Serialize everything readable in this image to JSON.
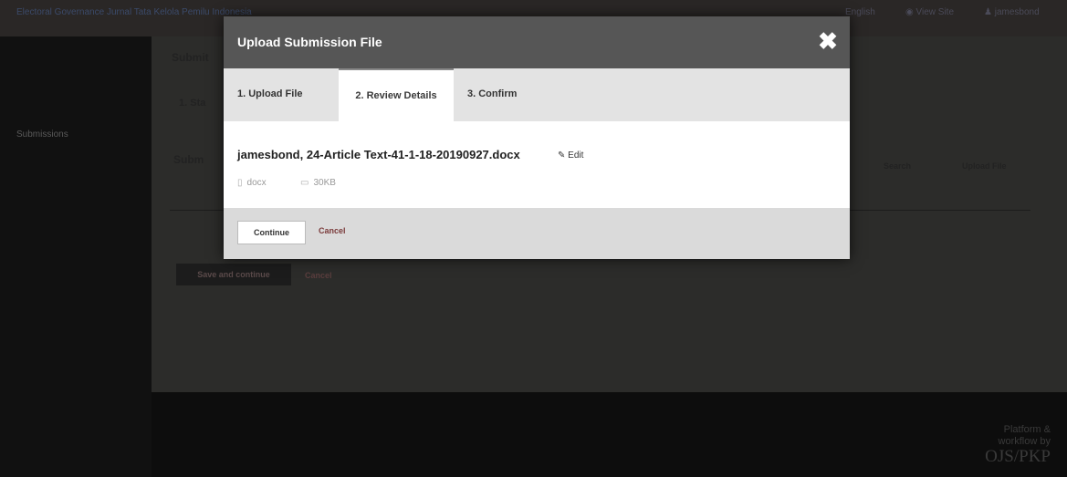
{
  "topbar": {
    "journal_title": "Electoral Governance Jurnal Tata Kelola Pemilu Indonesia",
    "language_label": "English",
    "view_site_label": "View Site",
    "user_label": "jamesbond"
  },
  "sidebar": {
    "items": [
      {
        "label": "Submissions"
      }
    ]
  },
  "background": {
    "heading": "Submit",
    "step": "1. Sta",
    "section": "Subm",
    "search_label": "Search",
    "upload_label": "Upload File",
    "save_button": "Save and continue",
    "cancel_link": "Cancel"
  },
  "footer": {
    "line1": "Platform &",
    "line2": "workflow by",
    "brand": "OJS/PKP"
  },
  "modal": {
    "title": "Upload Submission File",
    "close_symbol": "✖",
    "tabs": [
      {
        "label": "1. Upload File"
      },
      {
        "label": "2. Review Details"
      },
      {
        "label": "3. Confirm"
      }
    ],
    "file": {
      "name": "jamesbond, 24-Article Text-41-1-18-20190927.docx",
      "edit_label": "Edit",
      "type": "docx",
      "size": "30KB"
    },
    "continue_label": "Continue",
    "cancel_label": "Cancel"
  },
  "icons": {
    "close": "close-icon",
    "edit": "pencil-icon",
    "file": "file-icon",
    "size": "hdd-icon",
    "view_site": "eye-icon",
    "user": "user-icon"
  },
  "colors": {
    "modal_header": "#565656",
    "cancel_link": "#7a3a3a"
  }
}
